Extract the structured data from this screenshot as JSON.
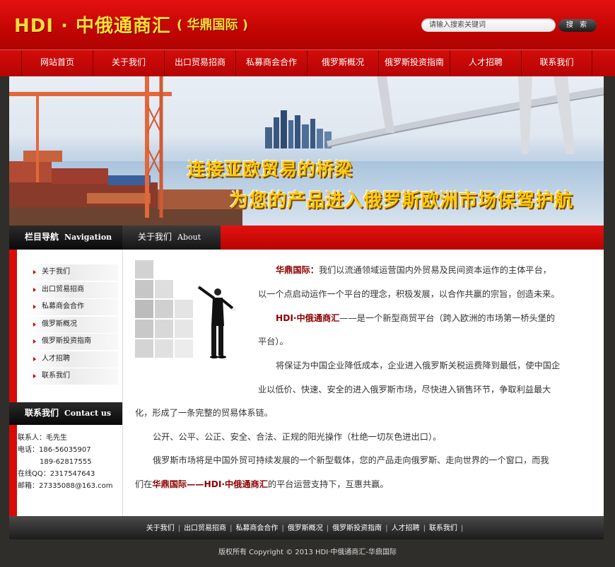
{
  "header": {
    "logo_main": "HDI · 中俄通商汇",
    "logo_sub": "( 华鼎国际 )",
    "search_placeholder": "请输入搜索关键词",
    "search_button": "搜 索"
  },
  "nav": {
    "items": [
      "网站首页",
      "关于我们",
      "出口贸易招商",
      "私募商会合作",
      "俄罗斯概况",
      "俄罗斯投资指南",
      "人才招聘",
      "联系我们"
    ]
  },
  "banner": {
    "slogan1": "连接亚欧贸易的桥梁",
    "slogan2": "为您的产品进入俄罗斯欧洲市场保驾护航"
  },
  "sidebar": {
    "title": "栏目导航",
    "title_en": "Navigation",
    "items": [
      "关于我们",
      "出口贸易招商",
      "私募商会合作",
      "俄罗斯概况",
      "俄罗斯投资指南",
      "人才招聘",
      "联系我们"
    ],
    "contact_title": "联系我们",
    "contact_title_en": "Contact us",
    "contact": {
      "person": "联系人：毛先生",
      "phone1": "电话：186-56035907",
      "phone2": "189-62817555",
      "qq": "在线QQ：2317547643",
      "email": "邮箱：27335088@163.com"
    }
  },
  "main": {
    "tab_title": "关于我们",
    "tab_title_en": "About",
    "p1_hl": "华鼎国际：",
    "p1_a": "我们以流通领域运营国内外贸易及民间资本运作的主体平台，",
    "p1_b": "以一个点启动运作一个平台的理念，积极发展，以合作共赢的宗旨，创造未来。",
    "p2_hl": "HDI·中俄通商汇",
    "p2_a": "——是一个新型商贸平台（跨入欧洲的市场第一桥头堡的",
    "p2_b": "平台）。",
    "p3_a": "将保证为中国企业降低成本，企业进入俄罗斯关税运费降到最低，使中国企",
    "p3_b": "业以低价、快速、安全的进入俄罗斯市场，尽快进入销售环节，争取利益最大",
    "p3_c": "化，形成了一条完整的贸易体系链。",
    "p4": "公开、公平、公正、安全、合法、正规的阳光操作（杜绝一切灰色进出口）。",
    "p5_a": "俄罗斯市场将是中国外贸可持续发展的一个新型载体，您的产品走向俄罗斯、走向世界的一个窗口，而我",
    "p5_b_pre": "们在",
    "p5_b_hl": "华鼎国际——HDI·中俄通商汇",
    "p5_b_post": "的平台运营支持下，互惠共赢。"
  },
  "footer": {
    "links": [
      "关于我们",
      "出口贸易招商",
      "私募商会合作",
      "俄罗斯概况",
      "俄罗斯投资指南",
      "人才招聘",
      "联系我们"
    ],
    "copyright": "版权所有 Copyright © 2013 HDI·中俄通商汇-华鼎国际"
  },
  "colors": {
    "header_red": "#c30503",
    "logo_yellow": "#ffdc3a",
    "highlight": "#8b0000",
    "dark": "#1c1c1c"
  }
}
